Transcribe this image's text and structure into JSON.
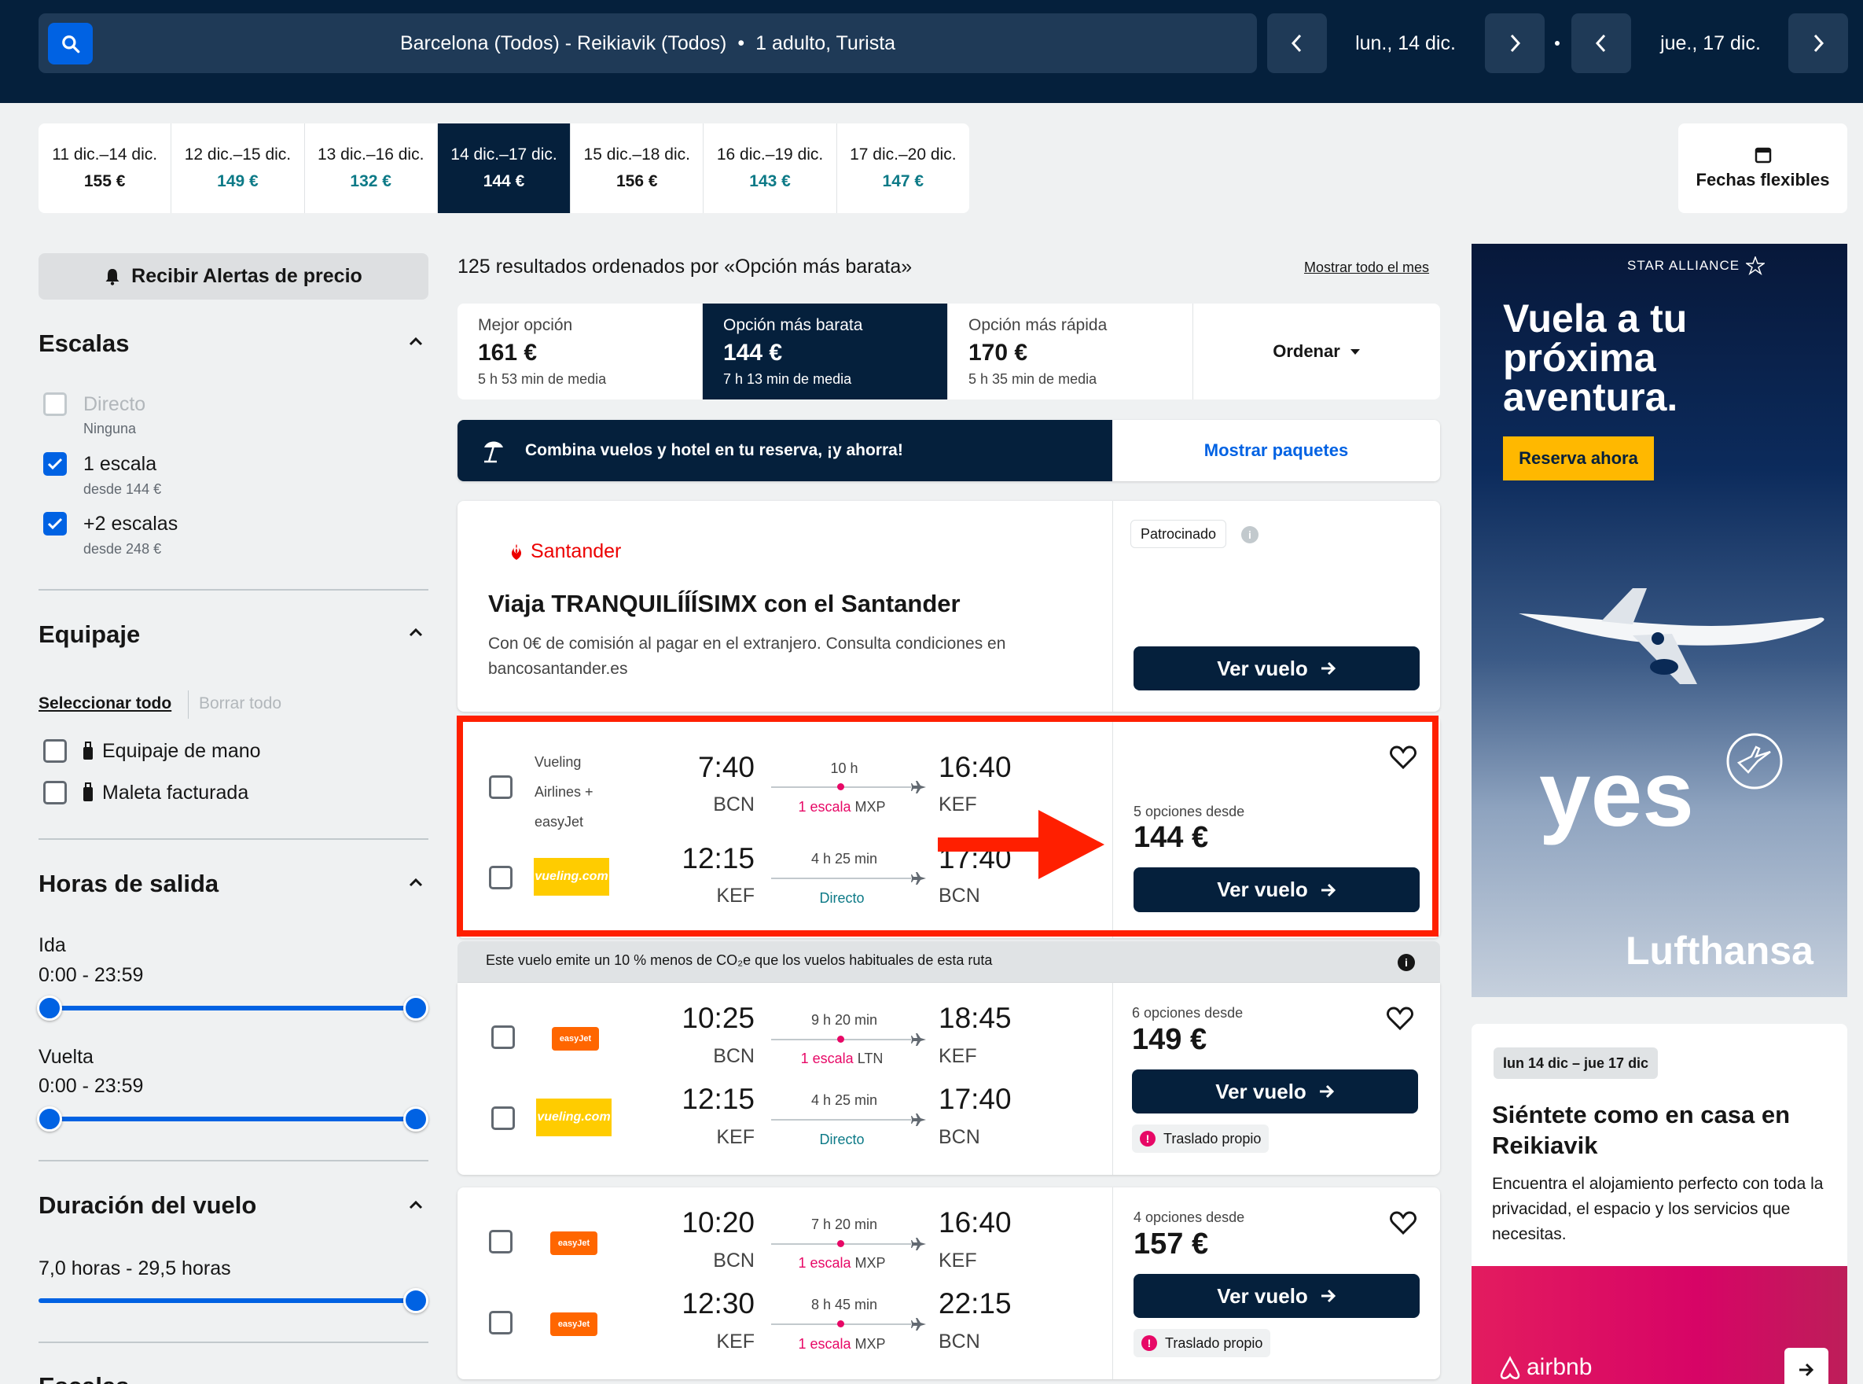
{
  "header": {
    "route": "Barcelona (Todos) - Reikiavik (Todos)",
    "travellers": "1 adulto, Turista",
    "depart_date": "lun., 14 dic.",
    "return_date": "jue., 17 dic."
  },
  "date_strip": [
    {
      "dates": "11 dic.–14 dic.",
      "price": "155 €",
      "cheap": false,
      "selected": false
    },
    {
      "dates": "12 dic.–15 dic.",
      "price": "149 €",
      "cheap": true,
      "selected": false
    },
    {
      "dates": "13 dic.–16 dic.",
      "price": "132 €",
      "cheap": true,
      "selected": false
    },
    {
      "dates": "14 dic.–17 dic.",
      "price": "144 €",
      "cheap": false,
      "selected": true
    },
    {
      "dates": "15 dic.–18 dic.",
      "price": "156 €",
      "cheap": false,
      "selected": false
    },
    {
      "dates": "16 dic.–19 dic.",
      "price": "143 €",
      "cheap": true,
      "selected": false
    },
    {
      "dates": "17 dic.–20 dic.",
      "price": "147 €",
      "cheap": true,
      "selected": false
    }
  ],
  "flexible_dates": "Fechas flexibles",
  "sidebar": {
    "price_alert": "Recibir Alertas de precio",
    "stops": {
      "title": "Escalas",
      "options": [
        {
          "label": "Directo",
          "sub": "Ninguna",
          "checked": false,
          "disabled": true
        },
        {
          "label": "1 escala",
          "sub": "desde 144 €",
          "checked": true,
          "disabled": false
        },
        {
          "label": "+2 escalas",
          "sub": "desde 248 €",
          "checked": true,
          "disabled": false
        }
      ]
    },
    "baggage": {
      "title": "Equipaje",
      "select_all": "Seleccionar todo",
      "clear_all": "Borrar todo",
      "options": [
        {
          "label": "Equipaje de mano",
          "checked": false
        },
        {
          "label": "Maleta facturada",
          "checked": false
        }
      ]
    },
    "times": {
      "title": "Horas de salida",
      "outbound_label": "Ida",
      "outbound_range": "0:00 - 23:59",
      "return_label": "Vuelta",
      "return_range": "0:00 - 23:59"
    },
    "duration": {
      "title": "Duración del vuelo",
      "range": "7,0 horas - 29,5 horas"
    },
    "next_section_partial": "Escalas"
  },
  "results": {
    "count_text": "125 resultados ordenados por «Opción más barata»",
    "month_link": "Mostrar todo el mes",
    "sort_tabs": [
      {
        "title": "Mejor opción",
        "price": "161 €",
        "sub": "5 h 53 min de media",
        "selected": false
      },
      {
        "title": "Opción más barata",
        "price": "144 €",
        "sub": "7 h 13 min de media",
        "selected": true
      },
      {
        "title": "Opción más rápida",
        "price": "170 €",
        "sub": "5 h 35 min de media",
        "selected": false
      }
    ],
    "sort_label": "Ordenar",
    "promo_text": "Combina vuelos y hotel en tu reserva, ¡y ahorra!",
    "promo_link": "Mostrar paquetes",
    "sponsored": {
      "brand": "Santander",
      "title": "Viaja TRANQUILÍÍÍSIMX con el Santander",
      "body": "Con 0€ de comisión al pagar en el extranjero. Consulta condiciones en bancosantander.es",
      "tag": "Patrocinado",
      "button": "Ver vuelo"
    },
    "co2_text": "Este vuelo emite un 10 % menos de CO₂e que los vuelos habituales de esta ruta",
    "flights": [
      {
        "airline_text": "Vueling Airlines + easyJet",
        "options": "5 opciones desde",
        "price": "144 €",
        "button": "Ver vuelo",
        "badge": "",
        "legs": [
          {
            "dep_time": "7:40",
            "dep_code": "BCN",
            "arr_time": "16:40",
            "arr_code": "KEF",
            "duration": "10 h",
            "stop_label": "1 escala",
            "stop_code": "MXP",
            "logo": "",
            "logo_text": ""
          },
          {
            "dep_time": "12:15",
            "dep_code": "KEF",
            "arr_time": "17:40",
            "arr_code": "BCN",
            "duration": "4 h 25 min",
            "stop_label": "Directo",
            "stop_code": "",
            "logo": "vueling",
            "logo_text": "vueling.com"
          }
        ]
      },
      {
        "airline_text": "",
        "options": "6 opciones desde",
        "price": "149 €",
        "button": "Ver vuelo",
        "badge": "Traslado propio",
        "legs": [
          {
            "dep_time": "10:25",
            "dep_code": "BCN",
            "arr_time": "18:45",
            "arr_code": "KEF",
            "duration": "9 h 20 min",
            "stop_label": "1 escala",
            "stop_code": "LTN",
            "logo": "easyjet",
            "logo_text": "easyJet"
          },
          {
            "dep_time": "12:15",
            "dep_code": "KEF",
            "arr_time": "17:40",
            "arr_code": "BCN",
            "duration": "4 h 25 min",
            "stop_label": "Directo",
            "stop_code": "",
            "logo": "vueling",
            "logo_text": "vueling.com"
          }
        ]
      },
      {
        "airline_text": "",
        "options": "4 opciones desde",
        "price": "157 €",
        "button": "Ver vuelo",
        "badge": "Traslado propio",
        "legs": [
          {
            "dep_time": "10:20",
            "dep_code": "BCN",
            "arr_time": "16:40",
            "arr_code": "KEF",
            "duration": "7 h 20 min",
            "stop_label": "1 escala",
            "stop_code": "MXP",
            "logo": "easyjet",
            "logo_text": "easyJet"
          },
          {
            "dep_time": "12:30",
            "dep_code": "KEF",
            "arr_time": "22:15",
            "arr_code": "BCN",
            "duration": "8 h 45 min",
            "stop_label": "1 escala",
            "stop_code": "MXP",
            "logo": "easyjet",
            "logo_text": "easyJet"
          }
        ]
      }
    ]
  },
  "ads": {
    "lufthansa": {
      "alliance": "STAR ALLIANCE",
      "headline": "Vuela a tu próxima aventura.",
      "cta": "Reserva ahora",
      "slogan": "yes",
      "brand": "Lufthansa"
    },
    "airbnb": {
      "dates": "lun 14 dic – jue 17 dic",
      "title": "Siéntete como en casa en Reikiavik",
      "body": "Encuentra el alojamiento perfecto con toda la privacidad, el espacio y los servicios que necesitas.",
      "brand": "airbnb"
    }
  },
  "colors": {
    "navy": "#05203c",
    "blue": "#0062e3",
    "teal": "#0d7a87",
    "pink": "#e70866",
    "highlight": "#ff1f00",
    "cta_yellow": "#ffb800"
  }
}
